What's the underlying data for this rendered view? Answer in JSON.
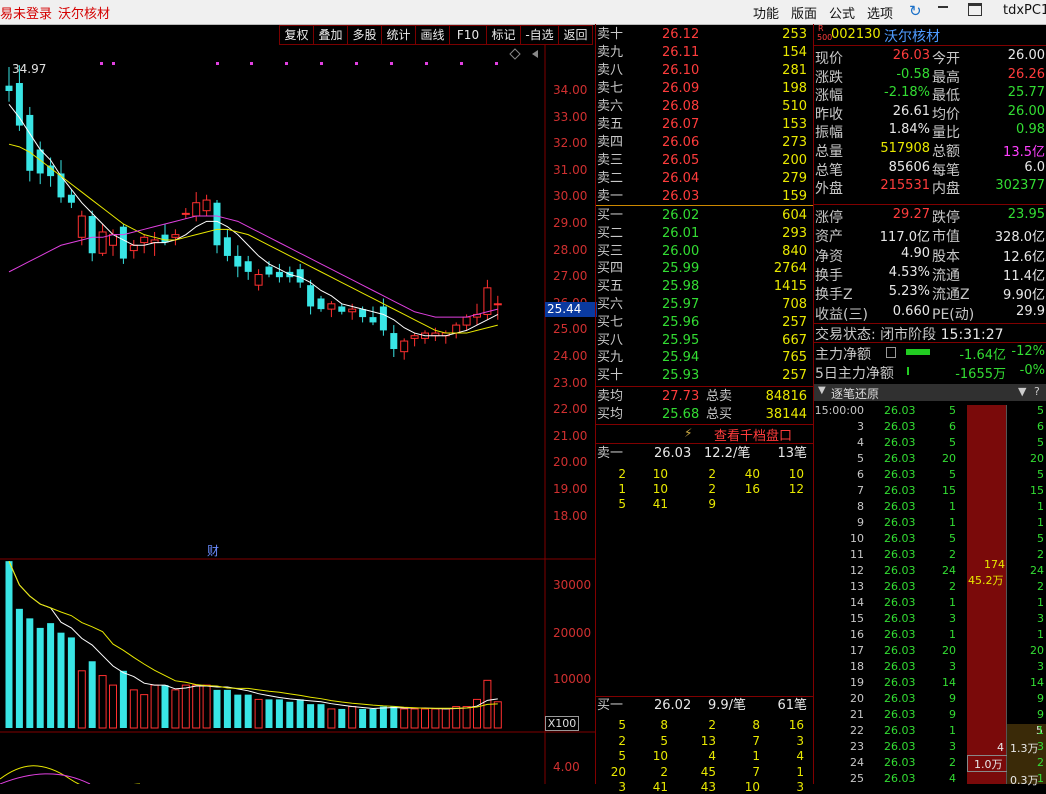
{
  "titlebar": {
    "left_text": "易未登录",
    "stock_name": "沃尔核材",
    "menus": [
      "功能",
      "版面",
      "公式",
      "选项"
    ],
    "account": "tdxPC1"
  },
  "toolbar": [
    "复权",
    "叠加",
    "多股",
    "统计",
    "画线",
    "F10",
    "标记",
    "-自选",
    "返回"
  ],
  "chart": {
    "high_label": "34.97",
    "price_axis": [
      "34.00",
      "33.00",
      "32.00",
      "31.00",
      "30.00",
      "29.00",
      "28.00",
      "27.00",
      "26.00",
      "25.00",
      "24.00",
      "23.00",
      "22.00",
      "21.00",
      "20.00",
      "19.00",
      "18.00"
    ],
    "current_price_tag": "25.44",
    "cai_marker": "财",
    "vol_axis": [
      "30000",
      "20000",
      "10000"
    ],
    "vol_unit": "X100",
    "ind_axis": "4.00"
  },
  "chart_data": [
    {
      "type": "candlestick",
      "ylim": [
        17.5,
        35.0
      ],
      "candles": [
        {
          "o": 34.2,
          "h": 34.9,
          "l": 33.6,
          "c": 34.0,
          "up": false
        },
        {
          "o": 34.3,
          "h": 34.97,
          "l": 32.5,
          "c": 32.7,
          "up": false
        },
        {
          "o": 33.1,
          "h": 33.4,
          "l": 30.6,
          "c": 31.0,
          "up": false
        },
        {
          "o": 31.8,
          "h": 32.1,
          "l": 30.5,
          "c": 30.9,
          "up": false
        },
        {
          "o": 31.2,
          "h": 31.5,
          "l": 30.4,
          "c": 30.8,
          "up": false
        },
        {
          "o": 30.9,
          "h": 31.4,
          "l": 29.8,
          "c": 30.0,
          "up": false
        },
        {
          "o": 30.1,
          "h": 30.3,
          "l": 29.6,
          "c": 29.8,
          "up": false
        },
        {
          "o": 28.5,
          "h": 29.5,
          "l": 28.2,
          "c": 29.3,
          "up": true
        },
        {
          "o": 29.3,
          "h": 29.5,
          "l": 27.6,
          "c": 27.9,
          "up": false
        },
        {
          "o": 27.9,
          "h": 29.0,
          "l": 27.8,
          "c": 28.7,
          "up": true
        },
        {
          "o": 28.6,
          "h": 28.8,
          "l": 27.8,
          "c": 28.2,
          "up": true
        },
        {
          "o": 28.9,
          "h": 29.0,
          "l": 27.5,
          "c": 27.7,
          "up": false
        },
        {
          "o": 28.0,
          "h": 28.4,
          "l": 27.7,
          "c": 28.2,
          "up": true
        },
        {
          "o": 28.3,
          "h": 28.6,
          "l": 27.9,
          "c": 28.5,
          "up": true
        },
        {
          "o": 28.4,
          "h": 28.7,
          "l": 27.8,
          "c": 28.3,
          "up": true
        },
        {
          "o": 28.6,
          "h": 29.0,
          "l": 28.2,
          "c": 28.3,
          "up": false
        },
        {
          "o": 28.5,
          "h": 28.8,
          "l": 28.2,
          "c": 28.6,
          "up": true
        },
        {
          "o": 29.4,
          "h": 29.6,
          "l": 29.2,
          "c": 29.4,
          "up": true
        },
        {
          "o": 29.3,
          "h": 30.2,
          "l": 29.1,
          "c": 29.8,
          "up": true
        },
        {
          "o": 29.5,
          "h": 30.1,
          "l": 29.3,
          "c": 29.9,
          "up": true
        },
        {
          "o": 29.8,
          "h": 29.9,
          "l": 27.9,
          "c": 28.2,
          "up": false
        },
        {
          "o": 28.5,
          "h": 28.8,
          "l": 27.6,
          "c": 27.8,
          "up": false
        },
        {
          "o": 27.8,
          "h": 28.2,
          "l": 27.0,
          "c": 27.4,
          "up": false
        },
        {
          "o": 27.6,
          "h": 27.8,
          "l": 26.9,
          "c": 27.2,
          "up": false
        },
        {
          "o": 27.1,
          "h": 27.3,
          "l": 26.5,
          "c": 26.7,
          "up": true
        },
        {
          "o": 27.4,
          "h": 27.6,
          "l": 27.0,
          "c": 27.1,
          "up": false
        },
        {
          "o": 27.2,
          "h": 27.5,
          "l": 26.8,
          "c": 27.0,
          "up": false
        },
        {
          "o": 27.0,
          "h": 27.4,
          "l": 26.8,
          "c": 27.2,
          "up": false
        },
        {
          "o": 27.3,
          "h": 27.5,
          "l": 26.6,
          "c": 26.8,
          "up": false
        },
        {
          "o": 26.7,
          "h": 26.9,
          "l": 25.6,
          "c": 25.9,
          "up": false
        },
        {
          "o": 26.2,
          "h": 26.3,
          "l": 25.7,
          "c": 25.8,
          "up": false
        },
        {
          "o": 25.8,
          "h": 26.1,
          "l": 25.5,
          "c": 26.0,
          "up": true
        },
        {
          "o": 25.9,
          "h": 26.0,
          "l": 25.6,
          "c": 25.7,
          "up": false
        },
        {
          "o": 25.7,
          "h": 26.0,
          "l": 25.4,
          "c": 25.8,
          "up": true
        },
        {
          "o": 25.8,
          "h": 25.9,
          "l": 25.3,
          "c": 25.5,
          "up": false
        },
        {
          "o": 25.5,
          "h": 25.9,
          "l": 25.2,
          "c": 25.3,
          "up": false
        },
        {
          "o": 25.9,
          "h": 26.2,
          "l": 24.8,
          "c": 25.0,
          "up": false
        },
        {
          "o": 24.9,
          "h": 25.2,
          "l": 24.0,
          "c": 24.3,
          "up": false
        },
        {
          "o": 24.2,
          "h": 24.7,
          "l": 23.9,
          "c": 24.6,
          "up": true
        },
        {
          "o": 24.7,
          "h": 24.9,
          "l": 24.4,
          "c": 24.8,
          "up": true
        },
        {
          "o": 24.7,
          "h": 25.0,
          "l": 24.5,
          "c": 24.9,
          "up": true
        },
        {
          "o": 24.8,
          "h": 25.1,
          "l": 24.6,
          "c": 24.9,
          "up": true
        },
        {
          "o": 24.8,
          "h": 25.0,
          "l": 24.5,
          "c": 24.9,
          "up": true
        },
        {
          "o": 24.9,
          "h": 25.3,
          "l": 24.7,
          "c": 25.2,
          "up": true
        },
        {
          "o": 25.2,
          "h": 25.6,
          "l": 25.0,
          "c": 25.5,
          "up": true
        },
        {
          "o": 25.5,
          "h": 26.0,
          "l": 25.2,
          "c": 25.6,
          "up": true
        },
        {
          "o": 25.6,
          "h": 26.9,
          "l": 25.4,
          "c": 26.6,
          "up": true
        },
        {
          "o": 26.0,
          "h": 26.3,
          "l": 25.4,
          "c": 26.0,
          "up": true
        }
      ],
      "ma5": [
        33.5,
        33.0,
        32.4,
        31.8,
        31.4,
        30.8,
        30.3,
        29.8,
        29.4,
        29.0,
        28.6,
        28.4,
        28.2,
        28.2,
        28.3,
        28.3,
        28.4,
        28.6,
        28.9,
        29.1,
        29.1,
        28.9,
        28.6,
        28.2,
        27.8,
        27.5,
        27.3,
        27.1,
        27.0,
        26.8,
        26.5,
        26.3,
        26.0,
        25.9,
        25.8,
        25.7,
        25.6,
        25.4,
        25.1,
        24.9,
        24.8,
        24.8,
        24.8,
        24.9,
        25.0,
        25.2,
        25.4,
        25.6
      ],
      "ma10": [
        32.0,
        31.9,
        31.7,
        31.4,
        31.1,
        30.8,
        30.5,
        30.2,
        29.9,
        29.6,
        29.3,
        29.0,
        28.8,
        28.6,
        28.5,
        28.4,
        28.4,
        28.5,
        28.6,
        28.7,
        28.8,
        28.8,
        28.7,
        28.6,
        28.4,
        28.2,
        28.0,
        27.8,
        27.6,
        27.4,
        27.2,
        27.0,
        26.8,
        26.6,
        26.4,
        26.2,
        26.0,
        25.8,
        25.6,
        25.4,
        25.2,
        25.0,
        24.9,
        24.9,
        24.9,
        25.0,
        25.1,
        25.2
      ],
      "ma20": [
        27.2,
        27.4,
        27.6,
        27.8,
        28.0,
        28.2,
        28.3,
        28.4,
        28.5,
        28.5,
        28.6,
        28.6,
        28.7,
        28.8,
        28.9,
        29.0,
        29.1,
        29.2,
        29.3,
        29.3,
        29.3,
        29.2,
        29.1,
        28.9,
        28.7,
        28.5,
        28.3,
        28.1,
        27.9,
        27.7,
        27.5,
        27.3,
        27.1,
        26.9,
        26.7,
        26.5,
        26.3,
        26.1,
        25.9,
        25.7,
        25.6,
        25.5,
        25.5,
        25.5,
        25.5,
        25.6,
        25.7,
        25.8
      ],
      "volumes": [
        35000,
        25000,
        23000,
        21000,
        22000,
        20000,
        19000,
        12000,
        14000,
        11000,
        9000,
        12000,
        8000,
        7000,
        9000,
        9000,
        8000,
        9000,
        9000,
        9000,
        8000,
        8000,
        7000,
        7000,
        6000,
        6000,
        6000,
        5500,
        6000,
        5000,
        5000,
        4000,
        4000,
        4500,
        4000,
        4000,
        4500,
        4500,
        4000,
        4000,
        4000,
        4000,
        4000,
        4500,
        4500,
        6000,
        10000,
        5500
      ],
      "vol_ylim": [
        0,
        34000
      ]
    }
  ],
  "quote": {
    "code_super": "R",
    "code_sub": "500",
    "code": "002130",
    "name": "沃尔核材",
    "rows": [
      [
        "现价",
        "26.03",
        "r",
        "今开",
        "26.00",
        "w"
      ],
      [
        "涨跌",
        "-0.58",
        "g",
        "最高",
        "26.26",
        "r"
      ],
      [
        "涨幅",
        "-2.18%",
        "g",
        "最低",
        "25.77",
        "g"
      ],
      [
        "昨收",
        "26.61",
        "w",
        "均价",
        "26.00",
        "g"
      ],
      [
        "振幅",
        "1.84%",
        "w",
        "量比",
        "0.98",
        "g"
      ],
      [
        "总量",
        "517908",
        "y",
        "总额",
        "13.5亿",
        "mag"
      ],
      [
        "总笔",
        "85606",
        "w",
        "每笔",
        "6.0",
        "w"
      ],
      [
        "外盘",
        "215531",
        "r",
        "内盘",
        "302377",
        "g"
      ]
    ],
    "rows2": [
      [
        "涨停",
        "29.27",
        "r",
        "跌停",
        "23.95",
        "g"
      ],
      [
        "资产",
        "117.0亿",
        "w",
        "市值",
        "328.0亿",
        "w"
      ],
      [
        "净资",
        "4.90",
        "w",
        "股本",
        "12.6亿",
        "w"
      ],
      [
        "换手",
        "4.53%",
        "w",
        "流通",
        "11.4亿",
        "w"
      ],
      [
        "换手Z",
        "5.23%",
        "w",
        "流通Z",
        "9.90亿",
        "w"
      ],
      [
        "收益(三)",
        "0.660",
        "w",
        "PE(动)",
        "29.9",
        "w"
      ]
    ],
    "trade_status_label": "交易状态:",
    "trade_status": "闭市阶段",
    "trade_time": "15:31:27",
    "main_net_label": "主力净额",
    "main_net": "-1.64亿",
    "main_net_pct": "-12%",
    "main5_label": "5日主力净额",
    "main5": "-1655万",
    "main5_pct": "-0%",
    "ticks_title": "逐笔还原"
  },
  "orderbook": {
    "sells": [
      [
        "卖十",
        "26.12",
        "253"
      ],
      [
        "卖九",
        "26.11",
        "154"
      ],
      [
        "卖八",
        "26.10",
        "281"
      ],
      [
        "卖七",
        "26.09",
        "198"
      ],
      [
        "卖六",
        "26.08",
        "510"
      ],
      [
        "卖五",
        "26.07",
        "153"
      ],
      [
        "卖四",
        "26.06",
        "273"
      ],
      [
        "卖三",
        "26.05",
        "200"
      ],
      [
        "卖二",
        "26.04",
        "279"
      ],
      [
        "卖一",
        "26.03",
        "159"
      ]
    ],
    "buys": [
      [
        "买一",
        "26.02",
        "604"
      ],
      [
        "买二",
        "26.01",
        "293"
      ],
      [
        "买三",
        "26.00",
        "840"
      ],
      [
        "买四",
        "25.99",
        "2764"
      ],
      [
        "买五",
        "25.98",
        "1415"
      ],
      [
        "买六",
        "25.97",
        "708"
      ],
      [
        "买七",
        "25.96",
        "257"
      ],
      [
        "买八",
        "25.95",
        "667"
      ],
      [
        "买九",
        "25.94",
        "765"
      ],
      [
        "买十",
        "25.93",
        "257"
      ]
    ],
    "sell_avg_label": "卖均",
    "sell_avg": "27.73",
    "sell_total_label": "总卖",
    "sell_total": "84816",
    "buy_avg_label": "买均",
    "buy_avg": "25.68",
    "buy_total_label": "总买",
    "buy_total": "38144",
    "qianqiao_button": "查看千档盘口",
    "sell1_queue": {
      "label": "卖一",
      "price": "26.03",
      "per": "12.2/笔",
      "count": "13笔",
      "rows": [
        [
          "2",
          "10",
          "2",
          "40",
          "10"
        ],
        [
          "1",
          "10",
          "2",
          "16",
          "12"
        ],
        [
          "5",
          "41",
          "9",
          "",
          ""
        ]
      ]
    },
    "buy1_queue": {
      "label": "买一",
      "price": "26.02",
      "per": "9.9/笔",
      "count": "61笔",
      "rows": [
        [
          "5",
          "8",
          "2",
          "8",
          "16"
        ],
        [
          "2",
          "5",
          "13",
          "7",
          "3"
        ],
        [
          "5",
          "10",
          "4",
          "1",
          "4"
        ],
        [
          "20",
          "2",
          "45",
          "7",
          "1"
        ],
        [
          "3",
          "41",
          "43",
          "10",
          "3"
        ]
      ]
    }
  },
  "ticks": {
    "rows": [
      [
        "15:00:00",
        "26.03",
        "5",
        "5"
      ],
      [
        "3",
        "26.03",
        "6",
        "6"
      ],
      [
        "4",
        "26.03",
        "5",
        "5"
      ],
      [
        "5",
        "26.03",
        "20",
        "20"
      ],
      [
        "6",
        "26.03",
        "5",
        "5"
      ],
      [
        "7",
        "26.03",
        "15",
        "15"
      ],
      [
        "8",
        "26.03",
        "1",
        "1"
      ],
      [
        "9",
        "26.03",
        "1",
        "1"
      ],
      [
        "10",
        "26.03",
        "5",
        "5"
      ],
      [
        "11",
        "26.03",
        "2",
        "2"
      ],
      [
        "12",
        "26.03",
        "24",
        "24"
      ],
      [
        "13",
        "26.03",
        "2",
        "2"
      ],
      [
        "14",
        "26.03",
        "1",
        "1"
      ],
      [
        "15",
        "26.03",
        "3",
        "3"
      ],
      [
        "16",
        "26.03",
        "1",
        "1"
      ],
      [
        "17",
        "26.03",
        "20",
        "20"
      ],
      [
        "18",
        "26.03",
        "3",
        "3"
      ],
      [
        "19",
        "26.03",
        "14",
        "14"
      ],
      [
        "20",
        "26.03",
        "9",
        "9"
      ],
      [
        "21",
        "26.03",
        "9",
        "9"
      ],
      [
        "22",
        "26.03",
        "1",
        "1"
      ],
      [
        "23",
        "26.03",
        "3",
        "3"
      ],
      [
        "24",
        "26.03",
        "2",
        "2"
      ],
      [
        "25",
        "26.03",
        "4",
        "1"
      ]
    ],
    "block_count": "174",
    "block_amount": "45.2万",
    "small_count": "4",
    "small_amount": "1.0万",
    "right_small_count": "5",
    "right_small_amount": "1.3万",
    "right_small_amount2": "0.3万"
  }
}
